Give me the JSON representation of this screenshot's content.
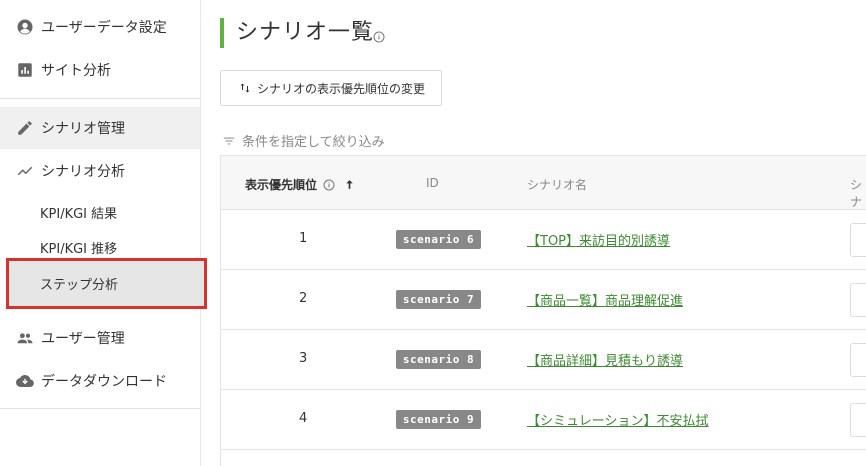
{
  "sidebar": {
    "items": [
      {
        "label": "ユーザーデータ設定",
        "icon": "user-circle-icon"
      },
      {
        "label": "サイト分析",
        "icon": "bar-chart-icon"
      },
      {
        "label": "シナリオ管理",
        "icon": "pencil-icon"
      },
      {
        "label": "シナリオ分析",
        "icon": "trend-line-icon"
      },
      {
        "label": "ユーザー管理",
        "icon": "people-icon"
      },
      {
        "label": "データダウンロード",
        "icon": "cloud-download-icon"
      }
    ],
    "sub_items": [
      {
        "label": "KPI/KGI 結果"
      },
      {
        "label": "KPI/KGI 推移"
      },
      {
        "label": "ステップ分析"
      }
    ]
  },
  "main": {
    "title": "シナリオ一覧",
    "order_button_label": "シナリオの表示優先順位の変更",
    "filter_label": "条件を指定して絞り込み",
    "columns": {
      "priority": "表示優先順位",
      "id": "ID",
      "name": "シナリオ名",
      "extra": "シナ"
    },
    "rows": [
      {
        "order": "1",
        "id": "scenario 6",
        "name": "【TOP】来訪目的別誘導"
      },
      {
        "order": "2",
        "id": "scenario 7",
        "name": "【商品一覧】商品理解促進"
      },
      {
        "order": "3",
        "id": "scenario 8",
        "name": "【商品詳細】見積もり誘導"
      },
      {
        "order": "4",
        "id": "scenario 9",
        "name": "【シミュレーション】不安払拭"
      }
    ]
  },
  "colors": {
    "accent": "#5db33e",
    "link": "#3d8a32",
    "highlight_border": "#d8322d",
    "badge": "#888888"
  }
}
